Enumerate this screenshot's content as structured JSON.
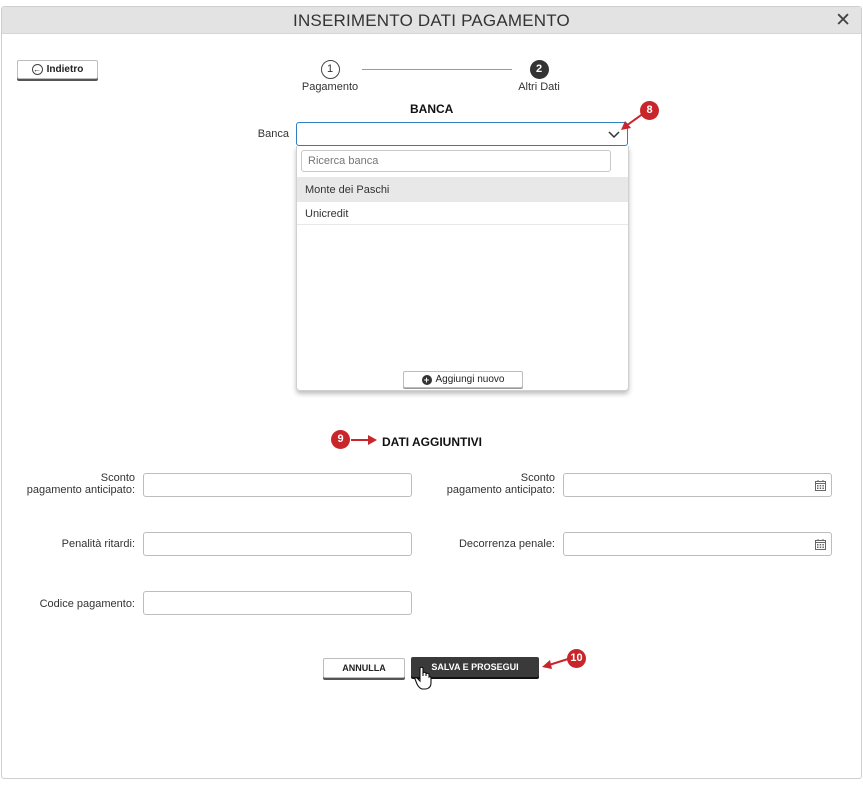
{
  "dialog": {
    "title": "INSERIMENTO DATI PAGAMENTO",
    "close_icon": "close-icon"
  },
  "toolbar": {
    "back_label": "Indietro",
    "back_icon": "arrow-left-circle-icon"
  },
  "stepper": {
    "steps": [
      {
        "number": "1",
        "label": "Pagamento",
        "active": false
      },
      {
        "number": "2",
        "label": "Altri Dati",
        "active": true
      }
    ]
  },
  "banca_section": {
    "title": "BANCA",
    "field_label": "Banca",
    "field_value": "",
    "dropdown": {
      "search_placeholder": "Ricerca banca",
      "options": [
        "Monte dei Paschi",
        "Unicredit"
      ],
      "highlighted": "Monte dei Paschi",
      "add_new_label": "Aggiungi nuovo"
    }
  },
  "dati_section": {
    "title": "DATI AGGIUNTIVI",
    "fields": {
      "sconto_left": {
        "label_line1": "Sconto",
        "label_line2": "pagamento anticipato:",
        "value": ""
      },
      "sconto_right": {
        "label_line1": "Sconto",
        "label_line2": "pagamento anticipato:",
        "value": ""
      },
      "penalita": {
        "label": "Penalità ritardi:",
        "value": ""
      },
      "decorrenza": {
        "label": "Decorrenza penale:",
        "value": ""
      },
      "codice": {
        "label": "Codice pagamento:",
        "value": ""
      }
    }
  },
  "actions": {
    "cancel_label": "ANNULLA",
    "save_label": "SALVA E PROSEGUI"
  },
  "annotations": {
    "marker_8": "8",
    "marker_9": "9",
    "marker_10": "10",
    "marker_color": "#c8262b"
  }
}
